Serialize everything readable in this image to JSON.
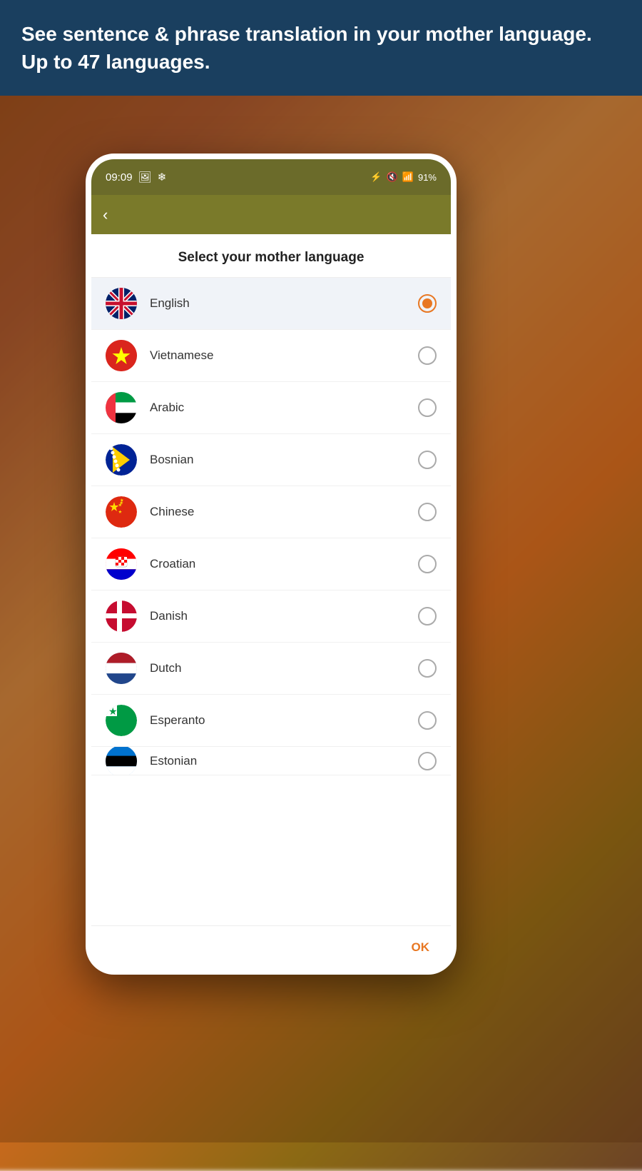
{
  "banner": {
    "text": "See sentence & phrase translation in your mother language. Up to 47 languages."
  },
  "status_bar": {
    "time": "09:09",
    "battery": "91%",
    "signal": "●●●●"
  },
  "dialog": {
    "title": "Select your mother language",
    "ok_button": "OK"
  },
  "languages": [
    {
      "id": "en",
      "name": "English",
      "selected": true,
      "flag_emoji": "🇬🇧"
    },
    {
      "id": "vi",
      "name": "Vietnamese",
      "selected": false,
      "flag_emoji": "🇻🇳"
    },
    {
      "id": "ar",
      "name": "Arabic",
      "selected": false,
      "flag_emoji": "🇦🇪"
    },
    {
      "id": "bs",
      "name": "Bosnian",
      "selected": false,
      "flag_emoji": "🇧🇦"
    },
    {
      "id": "zh",
      "name": "Chinese",
      "selected": false,
      "flag_emoji": "🇨🇳"
    },
    {
      "id": "hr",
      "name": "Croatian",
      "selected": false,
      "flag_emoji": "🇭🇷"
    },
    {
      "id": "da",
      "name": "Danish",
      "selected": false,
      "flag_emoji": "🇩🇰"
    },
    {
      "id": "nl",
      "name": "Dutch",
      "selected": false,
      "flag_emoji": "🇳🇱"
    },
    {
      "id": "eo",
      "name": "Esperanto",
      "selected": false,
      "flag_emoji": "🟢"
    },
    {
      "id": "et",
      "name": "Estonian",
      "selected": false,
      "flag_emoji": "🇪🇪"
    }
  ]
}
